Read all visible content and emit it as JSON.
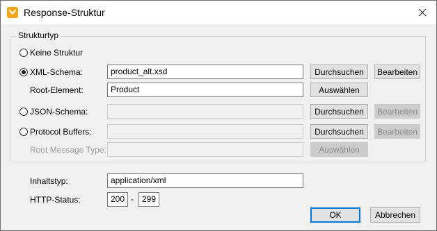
{
  "window": {
    "title": "Response-Struktur",
    "icon": "altova-app-icon",
    "close_glyph": "✕"
  },
  "structure_group": {
    "label": "Strukturtyp",
    "options": {
      "none": {
        "label": "Keine Struktur",
        "selected": false
      },
      "xml": {
        "label": "XML-Schema:",
        "selected": true,
        "value": "product_alt.xsd",
        "browse": "Durchsuchen",
        "edit": "Bearbeiten",
        "root_label": "Root-Element:",
        "root_value": "Product",
        "select": "Auswählen"
      },
      "json": {
        "label": "JSON-Schema:",
        "selected": false,
        "value": "",
        "browse": "Durchsuchen",
        "edit": "Bearbeiten"
      },
      "protobuf": {
        "label": "Protocol Buffers:",
        "selected": false,
        "value": "",
        "browse": "Durchsuchen",
        "edit": "Bearbeiten",
        "root_label": "Root Message Type:",
        "root_value": "",
        "select": "Auswählen"
      }
    }
  },
  "content_type": {
    "label": "Inhaltstyp:",
    "value": "application/xml"
  },
  "http_status": {
    "label": "HTTP-Status:",
    "from": "200",
    "separator": "-",
    "to": "299"
  },
  "footer": {
    "ok": "OK",
    "cancel": "Abbrechen"
  }
}
